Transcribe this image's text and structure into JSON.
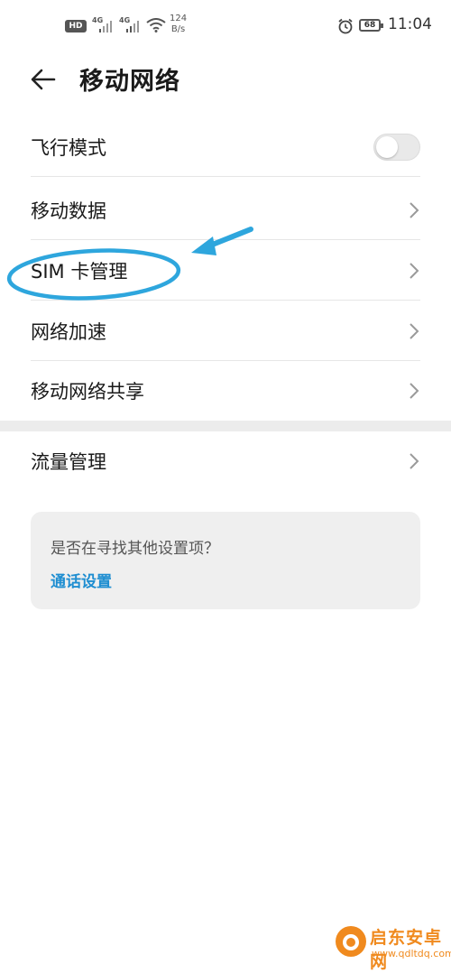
{
  "status_bar": {
    "hd_badge": "HD",
    "sim1_generation": "4G",
    "sim2_generation": "4G",
    "speed_value": "124",
    "speed_unit": "B/s",
    "battery_level": "68",
    "time": "11:04",
    "icons": [
      "hd-icon",
      "signal-icon",
      "signal-icon",
      "wifi-icon",
      "alarm-icon",
      "battery-icon"
    ]
  },
  "header": {
    "back_icon": "arrow-left-icon",
    "title": "移动网络"
  },
  "settings": {
    "items": [
      {
        "label": "飞行模式",
        "control": "toggle",
        "toggle_on": false
      },
      {
        "label": "移动数据",
        "control": "chevron"
      },
      {
        "label": "SIM 卡管理",
        "control": "chevron"
      },
      {
        "label": "网络加速",
        "control": "chevron"
      },
      {
        "label": "移动网络共享",
        "control": "chevron"
      },
      {
        "label": "流量管理",
        "control": "chevron"
      }
    ]
  },
  "suggestion_card": {
    "question": "是否在寻找其他设置项？",
    "link": "通话设置"
  },
  "annotation": {
    "highlight_target": "SIM 卡管理",
    "color": "#2ea6dd"
  },
  "watermark": {
    "site_name": "启东安卓网",
    "url": "www.qdltdq.com",
    "color": "#f08a1e"
  },
  "colors": {
    "accent": "#1f8ed1",
    "text": "#1a1a1a",
    "divider": "#e6e6e6"
  }
}
